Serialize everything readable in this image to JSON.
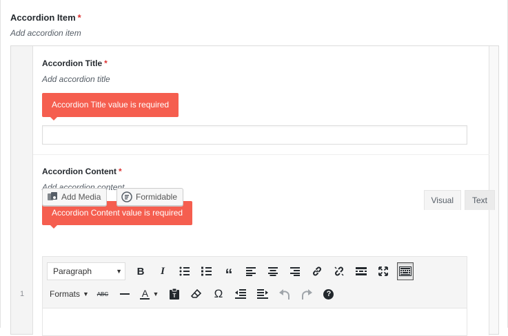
{
  "field": {
    "label": "Accordion Item",
    "required_mark": "*",
    "description": "Add accordion item"
  },
  "repeater": {
    "row_number": "1",
    "title_field": {
      "label": "Accordion Title",
      "required_mark": "*",
      "description": "Add accordion title",
      "error": "Accordion Title value is required",
      "value": ""
    },
    "content_field": {
      "label": "Accordion Content",
      "required_mark": "*",
      "description": "Add accordion content",
      "error": "Accordion Content value is required"
    }
  },
  "editor": {
    "add_media_label": "Add Media",
    "formidable_label": "Formidable",
    "tabs": [
      {
        "label": "Visual",
        "active": true
      },
      {
        "label": "Text",
        "active": false
      }
    ],
    "format_select": "Paragraph",
    "formats_dropdown": "Formats",
    "toolbar_row1_icons": [
      "bold-icon",
      "italic-icon",
      "bullet-list-icon",
      "numbered-list-icon",
      "blockquote-icon",
      "align-left-icon",
      "align-center-icon",
      "align-right-icon",
      "link-icon",
      "unlink-icon",
      "read-more-icon",
      "fullscreen-icon",
      "toolbar-toggle-icon"
    ],
    "toolbar_row2_icons": [
      "strikethrough-icon",
      "horizontal-line-icon",
      "text-color-icon",
      "paste-text-icon",
      "clear-formatting-icon",
      "special-character-icon",
      "outdent-icon",
      "indent-icon",
      "undo-icon",
      "redo-icon",
      "help-icon"
    ],
    "glyphs": {
      "bold": "B",
      "italic": "I",
      "blockquote": "“",
      "strikethrough": "ABC",
      "text_color": "A",
      "special_char": "Ω",
      "help": "?"
    }
  },
  "colors": {
    "error_bg": "#f55e4f",
    "required": "#dc3232",
    "toolbar_bg": "#f5f5f5"
  }
}
